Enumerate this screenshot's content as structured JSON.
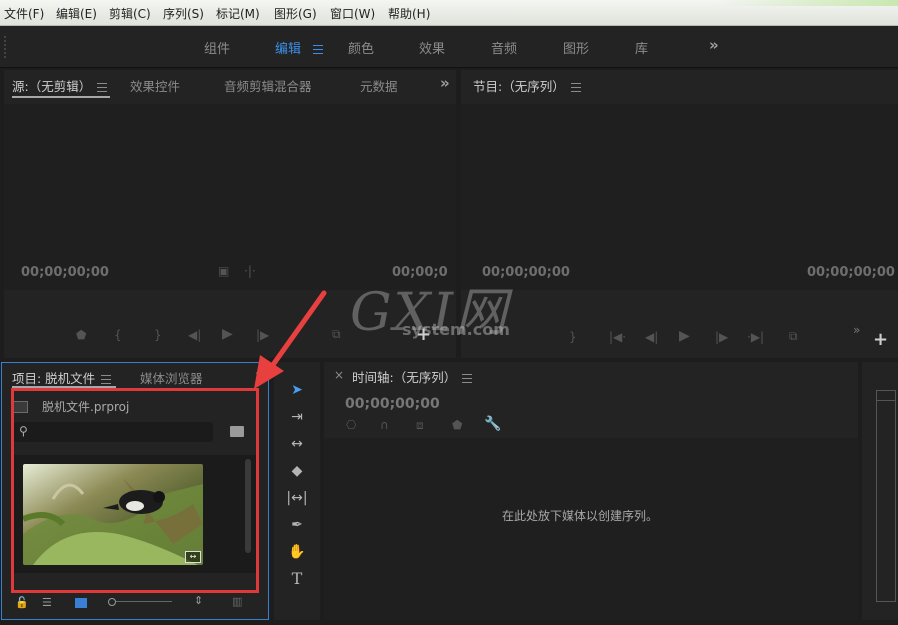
{
  "menu": [
    "文件(F)",
    "编辑(E)",
    "剪辑(C)",
    "序列(S)",
    "标记(M)",
    "图形(G)",
    "窗口(W)",
    "帮助(H)"
  ],
  "workspaces": {
    "tabs": [
      "组件",
      "编辑",
      "颜色",
      "效果",
      "音频",
      "图形",
      "库"
    ],
    "active": "编辑",
    "more": "»"
  },
  "source_panel": {
    "tabs": [
      "源:（无剪辑）",
      "效果控件",
      "音频剪辑混合器",
      "元数据"
    ],
    "timecode_left": "00;00;00;00",
    "timecode_right": "00;00;0",
    "more": "»"
  },
  "program_panel": {
    "title": "节目:（无序列）",
    "timecode_left": "00;00;00;00",
    "timecode_right": "00;00;00;00"
  },
  "project_panel": {
    "tabs": [
      "项目: 脱机文件",
      "媒体浏览器"
    ],
    "file_name": "脱机文件.prproj",
    "search_value": "",
    "more": "»"
  },
  "timeline_panel": {
    "close": "×",
    "title": "时间轴:（无序列）",
    "timecode": "00;00;00;00",
    "drop_hint": "在此处放下媒体以创建序列。"
  },
  "watermark": {
    "logo": "GXI网",
    "domain": "system.com"
  },
  "colors": {
    "accent": "#3a8fe8",
    "highlight_box": "#e0393a",
    "panel_border": "#3b7fd0"
  },
  "icons": {
    "tools": [
      "selection-tool",
      "track-select-tool",
      "ripple-edit-tool",
      "razor-tool",
      "slip-tool",
      "pen-tool",
      "hand-tool",
      "type-tool"
    ]
  }
}
